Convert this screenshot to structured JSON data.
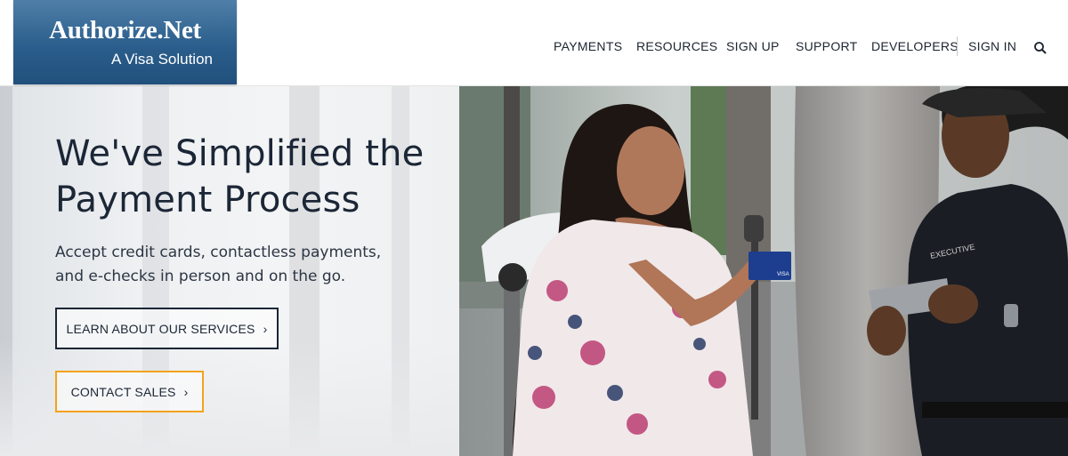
{
  "brand": {
    "name": "Authorize.Net",
    "tagline": "A Visa Solution"
  },
  "nav": {
    "items": [
      "PAYMENTS",
      "RESOURCES",
      "SIGN UP",
      "SUPPORT",
      "DEVELOPERS"
    ],
    "sign_in": "SIGN IN",
    "search_icon": "search-icon"
  },
  "hero": {
    "headline_line1": "We've Simplified the",
    "headline_line2": "Payment Process",
    "subtext_line1": "Accept credit cards, contactless payments,",
    "subtext_line2": "and e-checks in person and on the go.",
    "learn_button": "LEARN ABOUT OUR SERVICES",
    "contact_button": "CONTACT SALES",
    "chevron": "›"
  },
  "photo": {
    "shirt_text": "EXECUTIVE",
    "card_brand": "VISA"
  },
  "colors": {
    "logo_blue": "#2b5e8c",
    "text_dark": "#1b2636",
    "accent_orange": "#f4a21a"
  }
}
